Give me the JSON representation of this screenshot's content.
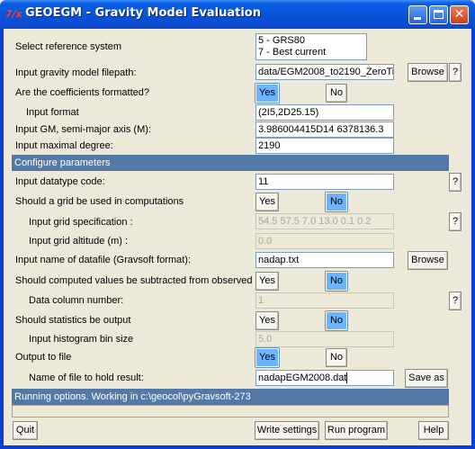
{
  "window": {
    "title": "GEOEGM - Gravity Model Evaluation",
    "icon": "tk-feather-icon",
    "accent_color": "#0A52D8"
  },
  "rows": {
    "ref_system": {
      "label": "Select reference system",
      "options": [
        "5 - GRS80",
        "7 - Best current"
      ]
    },
    "model_path": {
      "label": "Input gravity model filepath:",
      "value": "data/EGM2008_to2190_ZeroTi",
      "browse": "Browse",
      "help": "?"
    },
    "formatted": {
      "label": "Are the coefficients formatted?",
      "yes": "Yes",
      "no": "No",
      "selected": "Yes"
    },
    "input_format": {
      "label": "Input format",
      "value": "(2I5,2D25.15)"
    },
    "gm_axis": {
      "label": "Input GM, semi-major axis (M):",
      "value": "3.986004415D14 6378136.3"
    },
    "max_degree": {
      "label": "Input maximal degree:",
      "value": "2190"
    }
  },
  "configure_header": "Configure parameters",
  "params": {
    "datatype": {
      "label": "Input datatype code:",
      "value": "11",
      "help": "?"
    },
    "grid_use": {
      "label": "Should a grid be used in computations",
      "yes": "Yes",
      "no": "No",
      "selected": "No"
    },
    "grid_spec": {
      "label": "Input grid specification :",
      "value": "54.5 57.5 7.0 13.0 0.1 0.2",
      "help": "?"
    },
    "grid_alt": {
      "label": "Input grid altitude (m) :",
      "value": "0.0"
    },
    "datafile": {
      "label": "Input name of datafile (Gravsoft format):",
      "value": "nadap.txt",
      "browse": "Browse"
    },
    "subtract": {
      "label": "Should computed values be subtracted from observed",
      "yes": "Yes",
      "no": "No",
      "selected": "No"
    },
    "data_column": {
      "label": "Data column number:",
      "value": "1",
      "help": "?"
    },
    "statistics": {
      "label": "Should statistics be output",
      "yes": "Yes",
      "no": "No",
      "selected": "No"
    },
    "hist_bin": {
      "label": "Input histogram bin size",
      "value": "5.0"
    },
    "output_file": {
      "label": "Output to file",
      "yes": "Yes",
      "no": "No",
      "selected": "Yes"
    },
    "result_file": {
      "label": "Name of file to hold result:",
      "value": "nadapEGM2008.dat",
      "save_as": "Save as"
    }
  },
  "running_header": "Running options. Working in c:\\geocol\\pyGravsoft-273",
  "bottom": {
    "quit": "Quit",
    "write_settings": "Write settings",
    "run_program": "Run program",
    "help": "Help"
  }
}
